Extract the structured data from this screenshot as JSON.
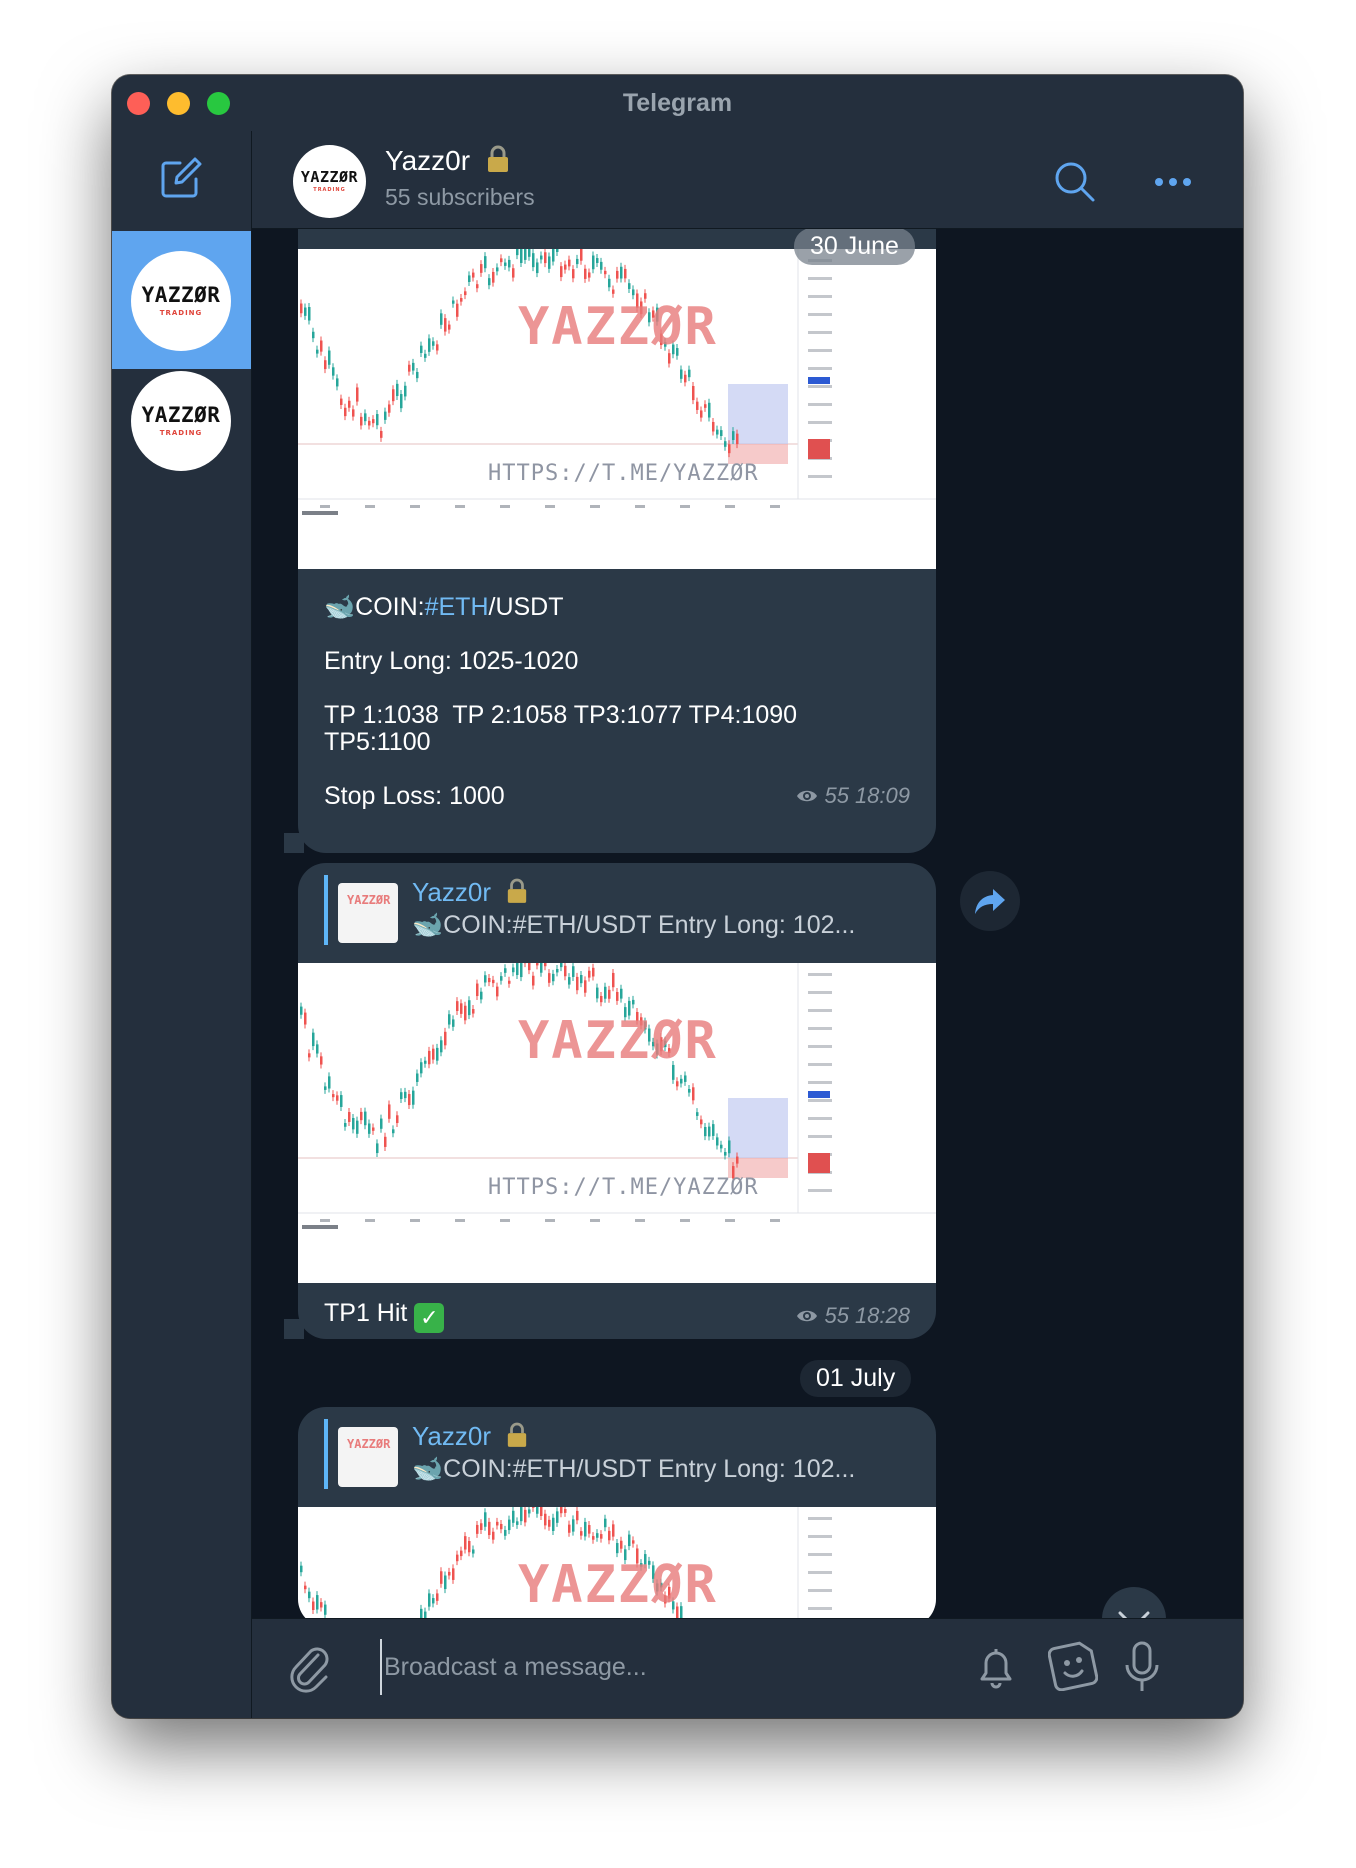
{
  "window": {
    "title": "Telegram"
  },
  "sidebar": {
    "chats": [
      {
        "logo_main": "YAZZØR",
        "logo_sub": "TRADING",
        "active": true
      },
      {
        "logo_main": "YAZZØR",
        "logo_sub": "TRADING",
        "active": false
      }
    ]
  },
  "header": {
    "channel_name": "Yazz0r",
    "subscribers": "55 subscribers",
    "avatar_main": "YAZZØR",
    "avatar_sub": "TRADING"
  },
  "dates": {
    "first": "30 June",
    "second": "01 July"
  },
  "chart_watermark": {
    "title": "YAZZØR",
    "url": "HTTPS://T.ME/YAZZØR"
  },
  "messages": [
    {
      "coin_prefix": "COIN:",
      "hashtag": "#ETH",
      "coin_suffix": "/USDT",
      "entry": "Entry Long: 1025-1020",
      "tp_line1": "TP 1:1038  TP 2:1058 TP3:1077 TP4:1090",
      "tp_line2": "TP5:1100",
      "stop": "Stop Loss: 1000",
      "views": "55",
      "time": "18:09"
    },
    {
      "reply_name": "Yazz0r",
      "reply_text": "COIN:#ETH/USDT  Entry Long: 102...",
      "text": "TP1 Hit",
      "views": "55",
      "time": "18:28"
    },
    {
      "reply_name": "Yazz0r",
      "reply_text": "COIN:#ETH/USDT  Entry Long: 102..."
    }
  ],
  "composer": {
    "placeholder": "Broadcast a message..."
  },
  "colors": {
    "accent": "#5fa5ef",
    "bubble": "#2b3947",
    "background": "#0e1621",
    "panel": "#242f3d"
  }
}
